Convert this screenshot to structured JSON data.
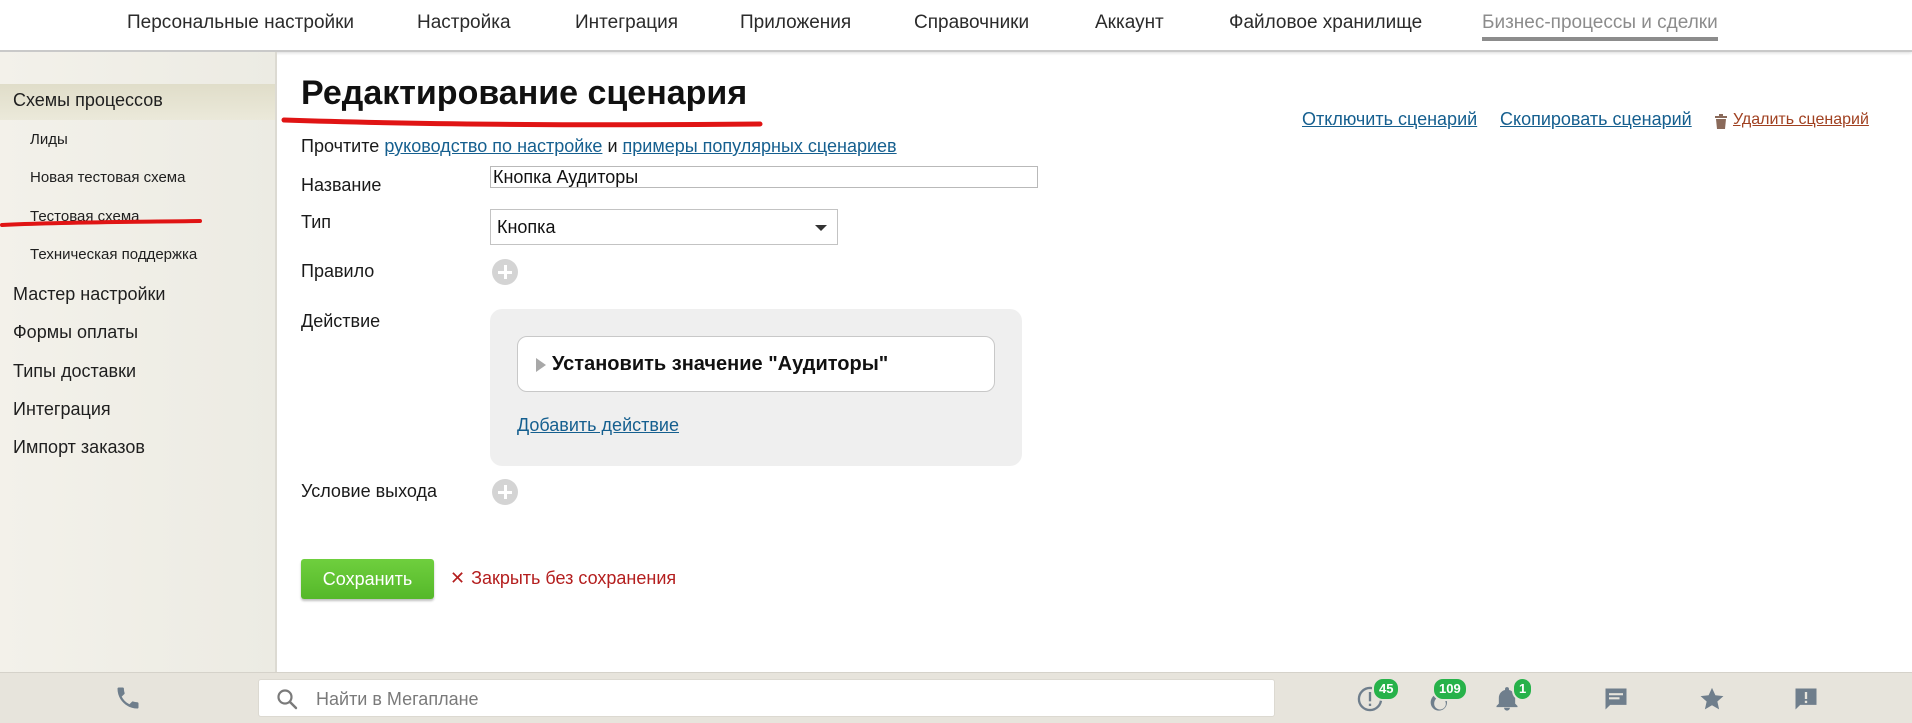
{
  "topnav": {
    "items": [
      "Персональные настройки",
      "Настройка",
      "Интеграция",
      "Приложения",
      "Справочники",
      "Аккаунт",
      "Файловое хранилище",
      "Бизнес-процессы и сделки"
    ],
    "active_index": 7
  },
  "sidebar": {
    "section_title": "Схемы процессов",
    "schemes": [
      "Лиды",
      "Новая тестовая схема",
      "Тестовая схема",
      "Техническая поддержка"
    ],
    "items": [
      "Мастер настройки",
      "Формы оплаты",
      "Типы доставки",
      "Интеграция",
      "Импорт заказов"
    ]
  },
  "main": {
    "title": "Редактирование сценария",
    "hint_prefix": "Прочтите",
    "hint_link1": "руководство по настройке",
    "hint_mid": "и",
    "hint_link2": "примеры популярных сценариев",
    "actions": {
      "disable": "Отключить сценарий",
      "copy": "Скопировать сценарий",
      "delete": "Удалить сценарий"
    },
    "fields": {
      "name_label": "Название",
      "name_value": "Кнопка Аудиторы",
      "type_label": "Тип",
      "type_value": "Кнопка",
      "rule_label": "Правило",
      "action_label": "Действие",
      "exit_label": "Условие выхода"
    },
    "action_card": "Установить значение \"Аудиторы\"",
    "add_action": "Добавить действие",
    "save": "Сохранить",
    "close": "Закрыть без сохранения"
  },
  "bottombar": {
    "search_placeholder": "Найти в Мегаплане",
    "badges": {
      "tasks": "45",
      "hot": "109",
      "notifications": "1"
    }
  },
  "colors": {
    "accent_link": "#155f8f",
    "save_green": "#5fc332",
    "badge_green": "#27b24a",
    "close_red": "#b41e1e",
    "annotation_red": "#e01414"
  },
  "icons": [
    "phone-icon",
    "search-icon",
    "tasks-alert-icon",
    "fire-icon",
    "bell-icon",
    "chat-icon",
    "star-icon",
    "feedback-icon",
    "trash-icon",
    "plus-circle-icon",
    "caret-down-icon",
    "expand-triangle-icon",
    "close-x-icon"
  ]
}
